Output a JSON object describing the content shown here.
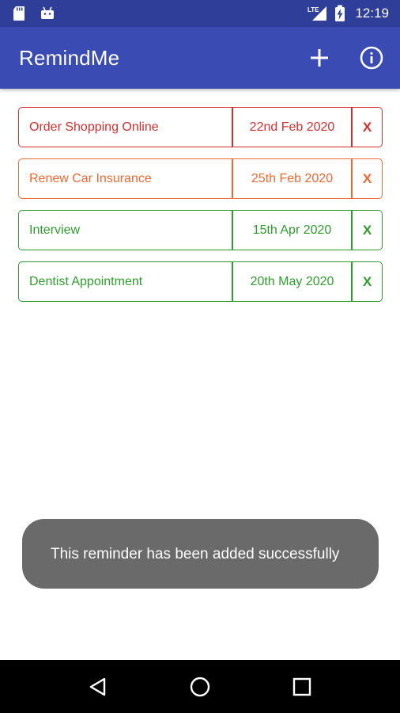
{
  "status_bar": {
    "time": "12:19",
    "network_label": "LTE",
    "icons": [
      "sd-card-icon",
      "android-icon",
      "lte-signal-icon",
      "battery-charging-icon"
    ]
  },
  "app_bar": {
    "title": "RemindMe",
    "actions": [
      "add-icon",
      "info-icon"
    ]
  },
  "reminders": [
    {
      "title": "Order Shopping Online",
      "date": "22nd Feb 2020",
      "delete_label": "X",
      "color": "#d32f2f"
    },
    {
      "title": "Renew Car Insurance",
      "date": "25th Feb 2020",
      "delete_label": "X",
      "color": "#f0672f"
    },
    {
      "title": "Interview",
      "date": "15th Apr 2020",
      "delete_label": "X",
      "color": "#2e9d2e"
    },
    {
      "title": "Dentist Appointment",
      "date": "20th May 2020",
      "delete_label": "X",
      "color": "#2e9d2e"
    }
  ],
  "toast": {
    "message": "This reminder has been added successfully"
  },
  "nav_bar": {
    "buttons": [
      "back-icon",
      "home-icon",
      "recents-icon"
    ]
  },
  "colors": {
    "status_bar": "#2f3f99",
    "app_bar": "#3a4cb3",
    "toast_bg": "#6a6a6a",
    "nav_bar": "#000000"
  }
}
